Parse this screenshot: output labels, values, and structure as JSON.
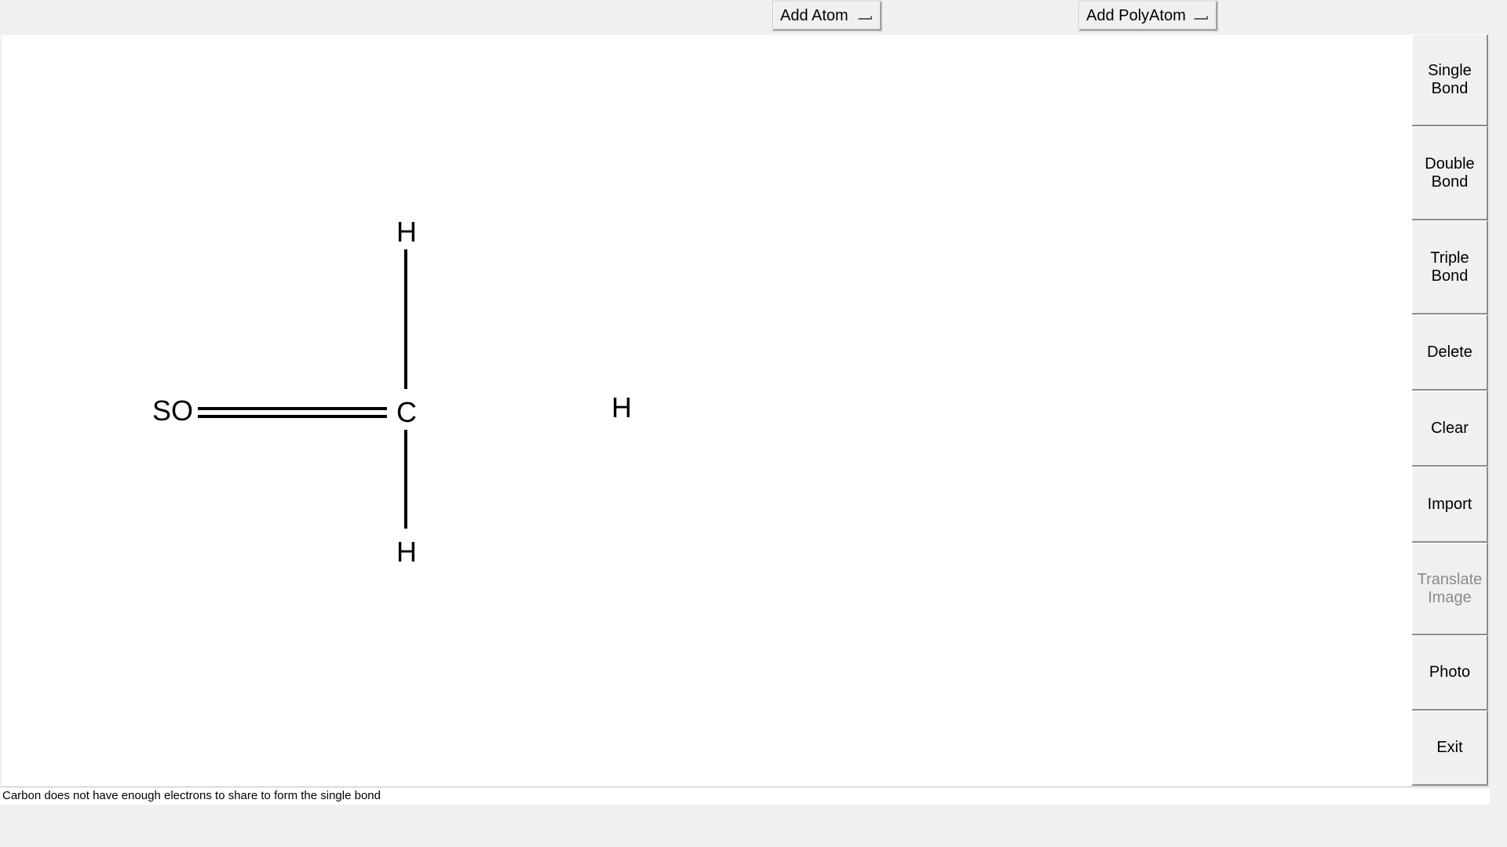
{
  "toolbar": {
    "add_atom_label": "Add Atom",
    "add_polyatom_label": "Add PolyAtom"
  },
  "canvas": {
    "atoms": {
      "so": "SO",
      "c": "C",
      "h_top": "H",
      "h_bottom": "H",
      "h_free": "H"
    },
    "bonds": [
      {
        "from": "SO",
        "to": "C",
        "type": "double"
      },
      {
        "from": "C",
        "to": "H (top)",
        "type": "single"
      },
      {
        "from": "C",
        "to": "H (bottom)",
        "type": "single"
      }
    ]
  },
  "sidebar": {
    "single_bond": "Single\nBond",
    "double_bond": "Double\nBond",
    "triple_bond": "Triple\nBond",
    "delete": "Delete",
    "clear": "Clear",
    "import": "Import",
    "translate_image": "Translate\nImage",
    "photo": "Photo",
    "exit": "Exit"
  },
  "status": {
    "message": "Carbon does not have enough electrons to share to form the single bond"
  }
}
